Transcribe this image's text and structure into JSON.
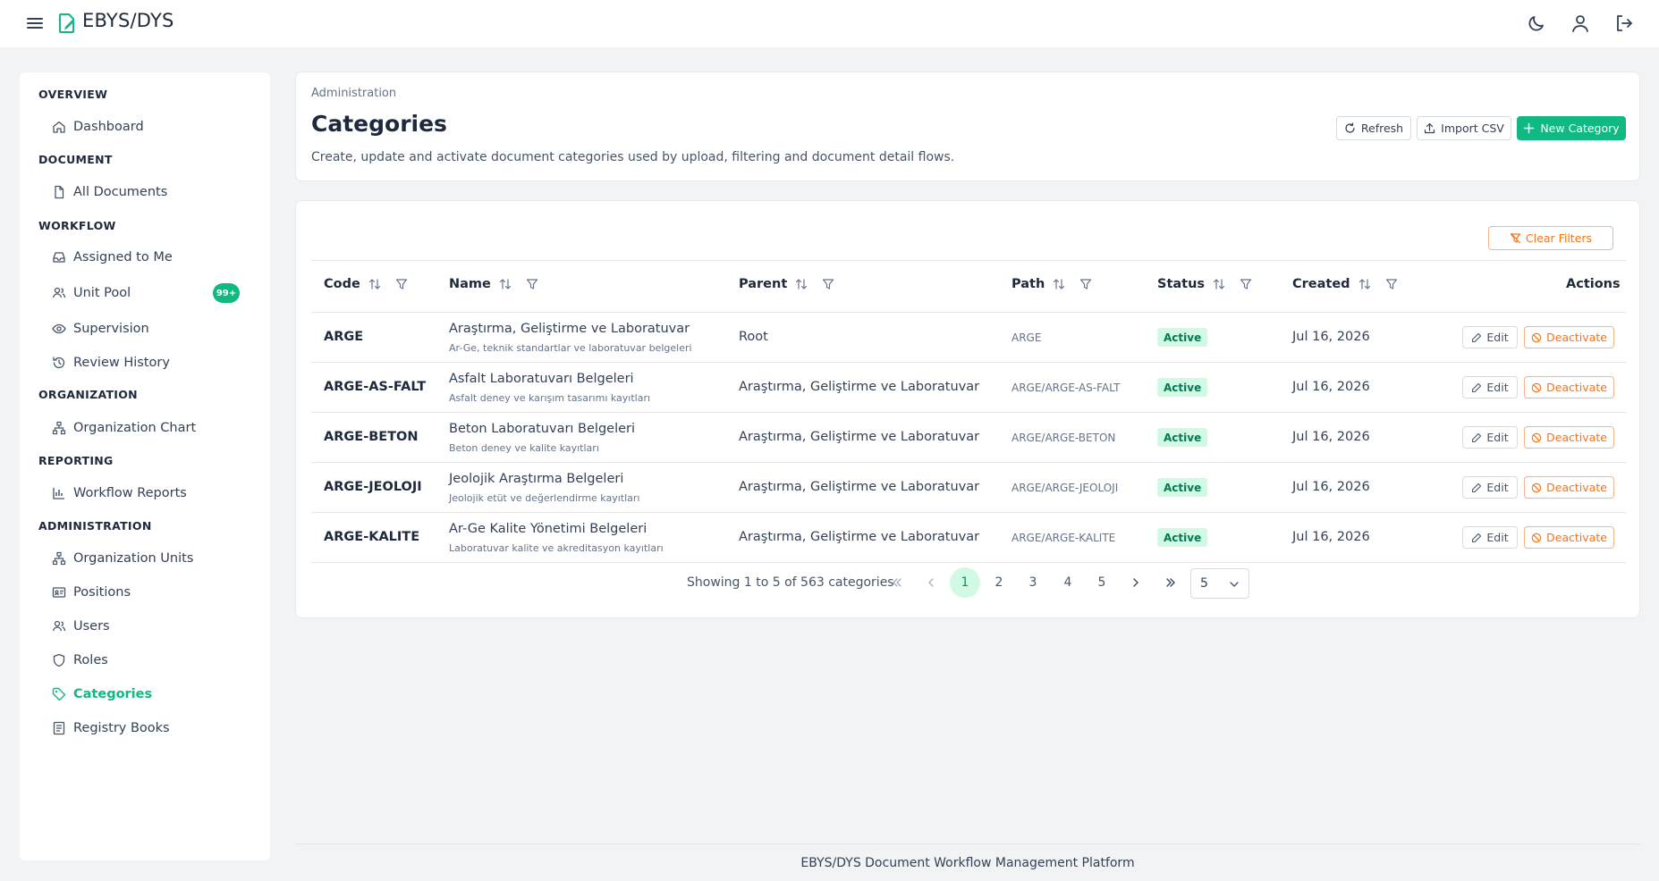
{
  "app": {
    "brand": "EBYS/DYS"
  },
  "colors": {
    "accent": "#10b981",
    "warning": "#f97316",
    "status_bg": "#d1fae5"
  },
  "sidebar": {
    "sections": [
      {
        "title": "OVERVIEW",
        "items": [
          {
            "label": "Dashboard",
            "icon": "home-icon"
          }
        ]
      },
      {
        "title": "DOCUMENT",
        "items": [
          {
            "label": "All Documents",
            "icon": "file-icon"
          }
        ]
      },
      {
        "title": "WORKFLOW",
        "items": [
          {
            "label": "Assigned to Me",
            "icon": "inbox-icon"
          },
          {
            "label": "Unit Pool",
            "icon": "users-icon",
            "badge": "99+"
          },
          {
            "label": "Supervision",
            "icon": "eye-icon"
          },
          {
            "label": "Review History",
            "icon": "history-icon"
          }
        ]
      },
      {
        "title": "ORGANIZATION",
        "items": [
          {
            "label": "Organization Chart",
            "icon": "sitemap-icon"
          }
        ]
      },
      {
        "title": "REPORTING",
        "items": [
          {
            "label": "Workflow Reports",
            "icon": "bar-chart-icon"
          }
        ]
      },
      {
        "title": "ADMINISTRATION",
        "items": [
          {
            "label": "Organization Units",
            "icon": "sitemap-icon"
          },
          {
            "label": "Positions",
            "icon": "id-card-icon"
          },
          {
            "label": "Users",
            "icon": "users-icon"
          },
          {
            "label": "Roles",
            "icon": "shield-icon"
          },
          {
            "label": "Categories",
            "icon": "tag-icon",
            "active": true
          },
          {
            "label": "Registry Books",
            "icon": "book-icon"
          }
        ]
      }
    ]
  },
  "header": {
    "breadcrumb": "Administration",
    "title": "Categories",
    "description": "Create, update and activate document categories used by upload, filtering and document detail flows.",
    "refresh_label": "Refresh",
    "import_label": "Import CSV",
    "new_label": "New Category"
  },
  "table": {
    "clear_filters_label": "Clear Filters",
    "columns": {
      "code": "Code",
      "name": "Name",
      "parent": "Parent",
      "path": "Path",
      "status": "Status",
      "created": "Created",
      "actions": "Actions"
    },
    "edit_label": "Edit",
    "deactivate_label": "Deactivate",
    "rows": [
      {
        "code": "ARGE",
        "name": "Araştırma, Geliştirme ve Laboratuvar",
        "subtitle": "Ar-Ge, teknik standartlar ve laboratuvar belgeleri",
        "parent": "Root",
        "path": "ARGE",
        "status": "Active",
        "created": "Jul 16, 2026"
      },
      {
        "code": "ARGE-AS-FALT",
        "name": "Asfalt Laboratuvarı Belgeleri",
        "subtitle": "Asfalt deney ve karışım tasarımı kayıtları",
        "parent": "Araştırma, Geliştirme ve Laboratuvar",
        "path": "ARGE/ARGE-AS-FALT",
        "status": "Active",
        "created": "Jul 16, 2026"
      },
      {
        "code": "ARGE-BETON",
        "name": "Beton Laboratuvarı Belgeleri",
        "subtitle": "Beton deney ve kalite kayıtları",
        "parent": "Araştırma, Geliştirme ve Laboratuvar",
        "path": "ARGE/ARGE-BETON",
        "status": "Active",
        "created": "Jul 16, 2026"
      },
      {
        "code": "ARGE-JEOLOJI",
        "name": "Jeolojik Araştırma Belgeleri",
        "subtitle": "Jeolojik etüt ve değerlendirme kayıtları",
        "parent": "Araştırma, Geliştirme ve Laboratuvar",
        "path": "ARGE/ARGE-JEOLOJI",
        "status": "Active",
        "created": "Jul 16, 2026"
      },
      {
        "code": "ARGE-KALITE",
        "name": "Ar-Ge Kalite Yönetimi Belgeleri",
        "subtitle": "Laboratuvar kalite ve akreditasyon kayıtları",
        "parent": "Araştırma, Geliştirme ve Laboratuvar",
        "path": "ARGE/ARGE-KALITE",
        "status": "Active",
        "created": "Jul 16, 2026"
      }
    ]
  },
  "pagination": {
    "summary": "Showing 1 to 5 of 563 categories",
    "pages": [
      "1",
      "2",
      "3",
      "4",
      "5"
    ],
    "current_page": "1",
    "page_size": "5"
  },
  "footer": {
    "text": "EBYS/DYS Document Workflow Management Platform"
  }
}
